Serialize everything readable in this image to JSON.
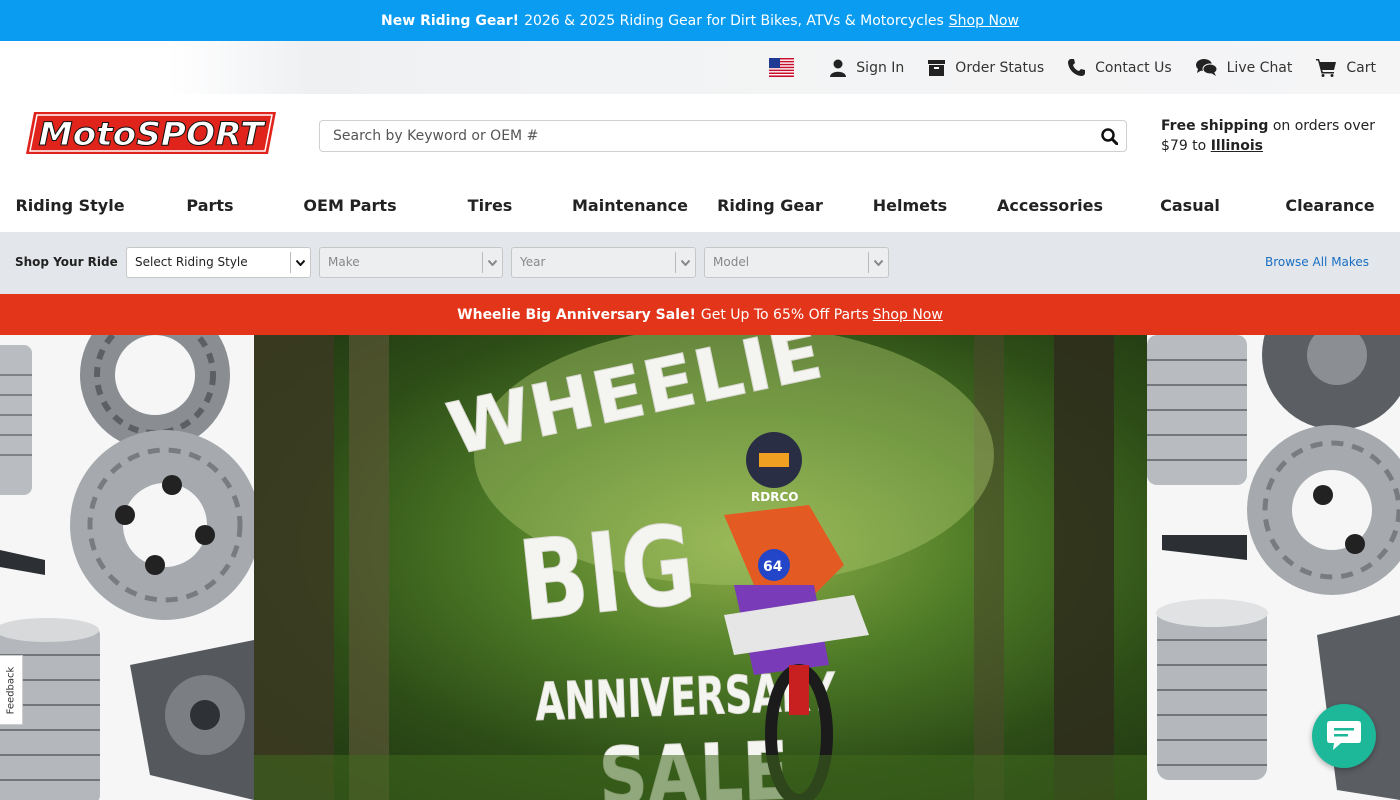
{
  "top_promo": {
    "bold": "New Riding Gear!",
    "text": "2026 & 2025 Riding Gear for Dirt Bikes, ATVs & Motorcycles",
    "link": "Shop Now"
  },
  "utility": {
    "sign_in": "Sign In",
    "order_status": "Order Status",
    "contact_us": "Contact Us",
    "live_chat": "Live Chat",
    "cart": "Cart"
  },
  "header": {
    "logo_text": "MotoSPORT",
    "search_placeholder": "Search by Keyword or OEM #",
    "shipping_bold": "Free shipping",
    "shipping_text": "on orders over $79 to",
    "shipping_state": "Illinois"
  },
  "nav": [
    {
      "label": "Riding Style"
    },
    {
      "label": "Parts"
    },
    {
      "label": "OEM Parts"
    },
    {
      "label": "Tires"
    },
    {
      "label": "Maintenance"
    },
    {
      "label": "Riding Gear"
    },
    {
      "label": "Helmets"
    },
    {
      "label": "Accessories"
    },
    {
      "label": "Casual"
    },
    {
      "label": "Clearance"
    }
  ],
  "shop_ride": {
    "label": "Shop Your Ride",
    "riding_style": "Select Riding Style",
    "make": "Make",
    "year": "Year",
    "model": "Model",
    "browse_all": "Browse All Makes"
  },
  "sale_promo": {
    "bold": "Wheelie Big Anniversary Sale!",
    "text": "Get Up To 65% Off Parts",
    "link": "Shop Now"
  },
  "hero": {
    "line1": "WHEELIE",
    "line2": "BIG",
    "line3": "ANNIVERSARY",
    "line4": "SALE",
    "rider_number": "64",
    "rider_brand": "RDRCO"
  },
  "feedback": "Feedback",
  "colors": {
    "top_bar": "#0a9cf0",
    "sale_bar": "#e2351a",
    "logo_red": "#e0241c",
    "chat": "#1db899",
    "ride_bar": "#e3e6ea"
  }
}
